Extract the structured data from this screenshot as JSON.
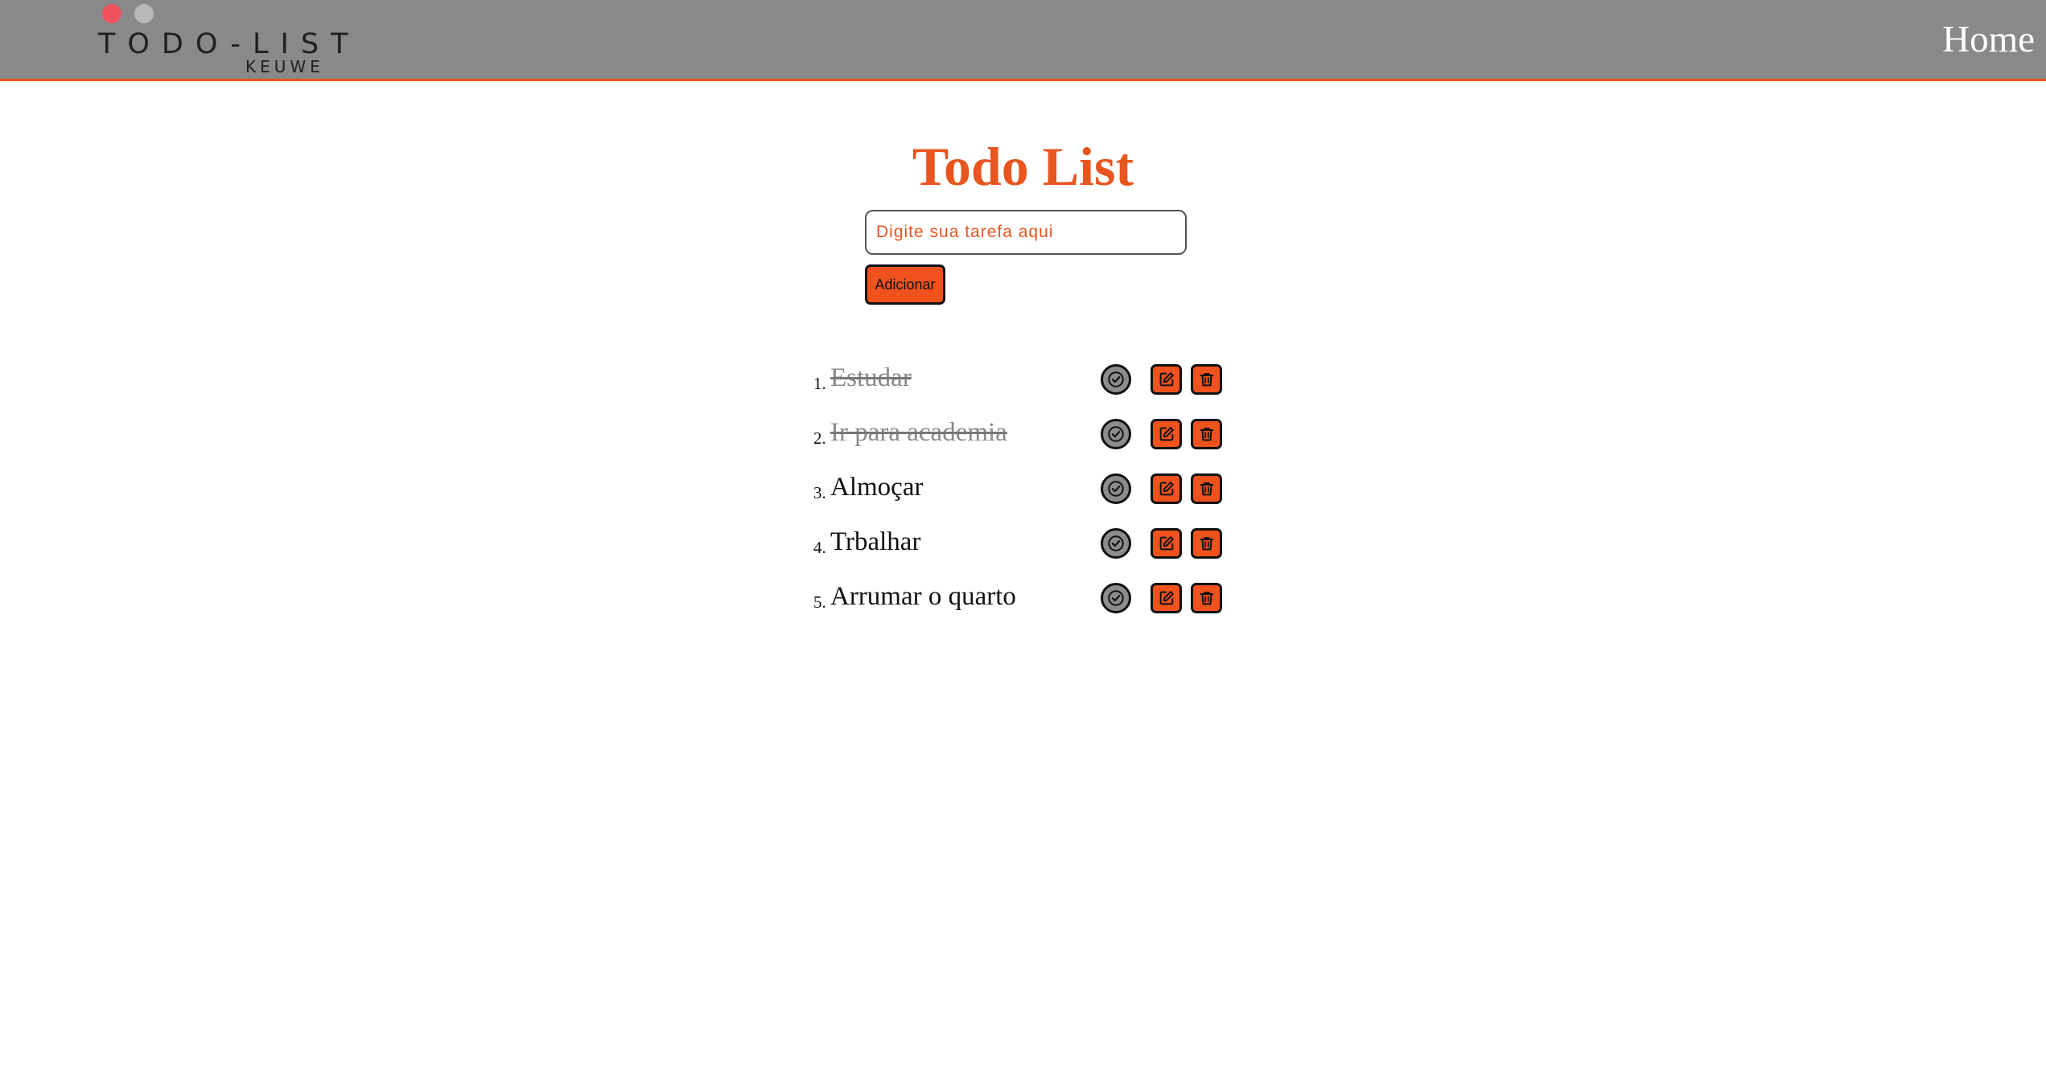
{
  "header": {
    "logo_main": "TODO-LIST",
    "logo_sub": "KEUWE",
    "nav_home": "Home",
    "window_dots": [
      "red-dot",
      "grey-dot"
    ]
  },
  "main": {
    "title": "Todo List",
    "input": {
      "placeholder": "Digite sua tarefa aqui",
      "value": ""
    },
    "add_button_label": "Adicionar"
  },
  "tasks": [
    {
      "number": "1.",
      "text": "Estudar",
      "done": true
    },
    {
      "number": "2.",
      "text": "Ir para academia",
      "done": true
    },
    {
      "number": "3.",
      "text": "Almoçar",
      "done": false
    },
    {
      "number": "4.",
      "text": "Trbalhar",
      "done": false
    },
    {
      "number": "5.",
      "text": "Arrumar o quarto",
      "done": false
    }
  ],
  "icons": {
    "complete": "check-circle-icon",
    "edit": "edit-icon",
    "delete": "trash-icon"
  },
  "colors": {
    "accent": "#e8551f",
    "button_bg": "#f0521d",
    "header_bg": "#898989",
    "done_text": "#8a8a8a",
    "complete_button_bg": "#8c8c8c"
  }
}
